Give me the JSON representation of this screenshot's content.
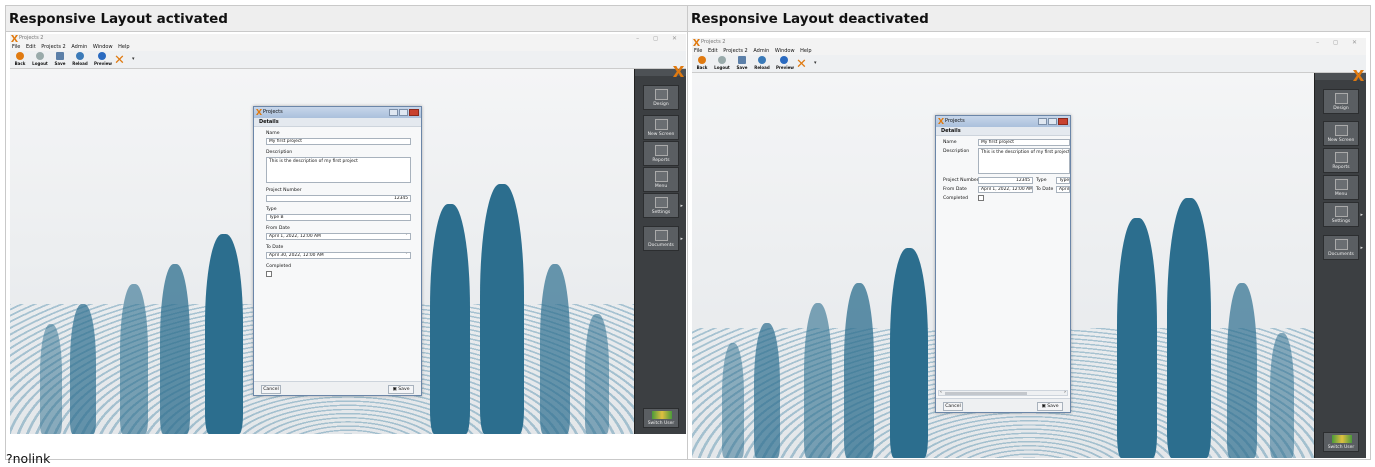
{
  "headers": {
    "left": "Responsive Layout activated",
    "right": "Responsive Layout deactivated"
  },
  "footer_text": "?nolink",
  "app": {
    "window_title": "Projects 2",
    "window_controls": "– ◻ ✕",
    "menu": [
      "File",
      "Edit",
      "Projects 2",
      "Admin",
      "Window",
      "Help"
    ],
    "toolbar": [
      "Back",
      "Logout",
      "Save",
      "Reload",
      "Preview"
    ],
    "toolbar_dropdown": "▾"
  },
  "sidebar": {
    "buttons": [
      "Design",
      "New Screen",
      "Reports",
      "Menu",
      "Settings",
      "Documents"
    ],
    "switch_user": "Switch User",
    "dropdown_arrow": "▸"
  },
  "dialog": {
    "title": "Projects",
    "tab": "Details",
    "labels": {
      "name": "Name",
      "description": "Description",
      "project_number": "Project Number",
      "type": "Type",
      "from_date": "From Date",
      "to_date": "To Date",
      "completed": "Completed"
    },
    "values": {
      "name": "My first project",
      "description": "This is the description of my first project",
      "project_number": "12345",
      "type": "Type B",
      "type_truncated": "Type E",
      "from_date": "April 1, 2022, 12:00 AM",
      "to_date": "April 30, 2022, 12:00 AM",
      "to_date_truncated": "April"
    },
    "buttons": {
      "cancel": "Cancel",
      "save": "Save"
    },
    "dropdown_chevron": "﹀",
    "scroll_left": "‹",
    "scroll_right": "›"
  },
  "colors": {
    "accent": "#e07a10",
    "sidebar": "#3c3f42",
    "silhouette": "#2c6e8e"
  }
}
